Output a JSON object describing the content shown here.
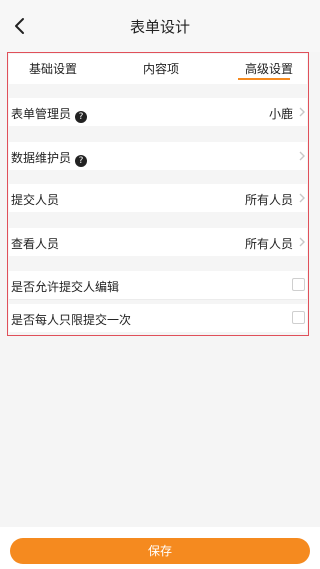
{
  "header": {
    "title": "表单设计",
    "back_icon": "chevron-left-icon"
  },
  "tabs": [
    {
      "label": "基础设置",
      "active": false
    },
    {
      "label": "内容项",
      "active": false
    },
    {
      "label": "高级设置",
      "active": true
    }
  ],
  "rows": {
    "form_admin": {
      "label": "表单管理员",
      "value": "小鹿"
    },
    "data_maintainer": {
      "label": "数据维护员",
      "value": ""
    },
    "submitter": {
      "label": "提交人员",
      "value": "所有人员"
    },
    "viewer": {
      "label": "查看人员",
      "value": "所有人员"
    }
  },
  "toggles": {
    "allow_submitter_edit": {
      "label": "是否允许提交人编辑",
      "checked": false
    },
    "once_per_person": {
      "label": "是否每人只限提交一次",
      "checked": false
    }
  },
  "footer": {
    "save_label": "保存"
  },
  "colors": {
    "accent": "#f58a1f",
    "highlight_frame": "#e0505a"
  }
}
